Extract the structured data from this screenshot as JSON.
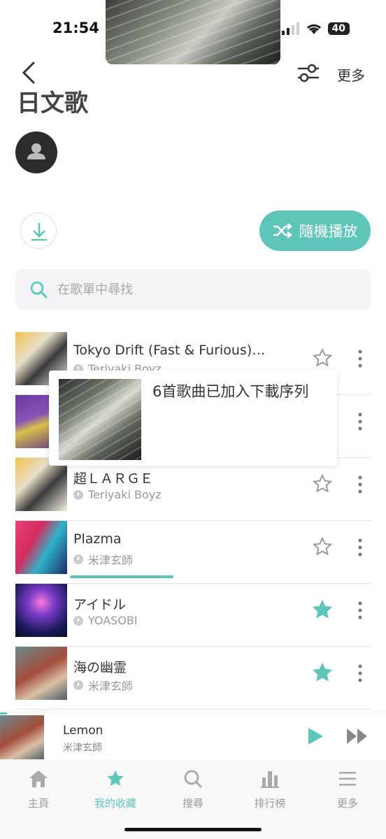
{
  "status_bar": {
    "time": "21:54",
    "battery": "40"
  },
  "header": {
    "more_label": "更多",
    "title": "日文歌"
  },
  "actions": {
    "shuffle_label": "隨機播放"
  },
  "search": {
    "placeholder": "在歌單中尋找"
  },
  "songs": [
    {
      "name": "Tokyo Drift (Fast & Furious)…",
      "artist": "Teriyaki Boyz",
      "favorited": false
    },
    {
      "name": "",
      "artist": "",
      "favorited": false
    },
    {
      "name": "超ＬＡＲＧＥ",
      "artist": "Teriyaki Boyz",
      "favorited": false
    },
    {
      "name": "Plazma",
      "artist": "米津玄師",
      "favorited": false
    },
    {
      "name": "アイドル",
      "artist": "YOASOBI",
      "favorited": true
    },
    {
      "name": "海の幽霊",
      "artist": "米津玄師",
      "favorited": true
    }
  ],
  "toast": {
    "message": "6首歌曲已加入下載序列"
  },
  "now_playing": {
    "title": "Lemon",
    "artist": "米津玄師"
  },
  "tabs": [
    {
      "label": "主頁",
      "icon": "home-icon",
      "active": false
    },
    {
      "label": "我的收藏",
      "icon": "star-icon",
      "active": true
    },
    {
      "label": "搜尋",
      "icon": "search-icon",
      "active": false
    },
    {
      "label": "排行榜",
      "icon": "chart-icon",
      "active": false
    },
    {
      "label": "更多",
      "icon": "menu-icon",
      "active": false
    }
  ],
  "colors": {
    "accent": "#5dc6b8",
    "text": "#333333",
    "muted": "#999999"
  }
}
